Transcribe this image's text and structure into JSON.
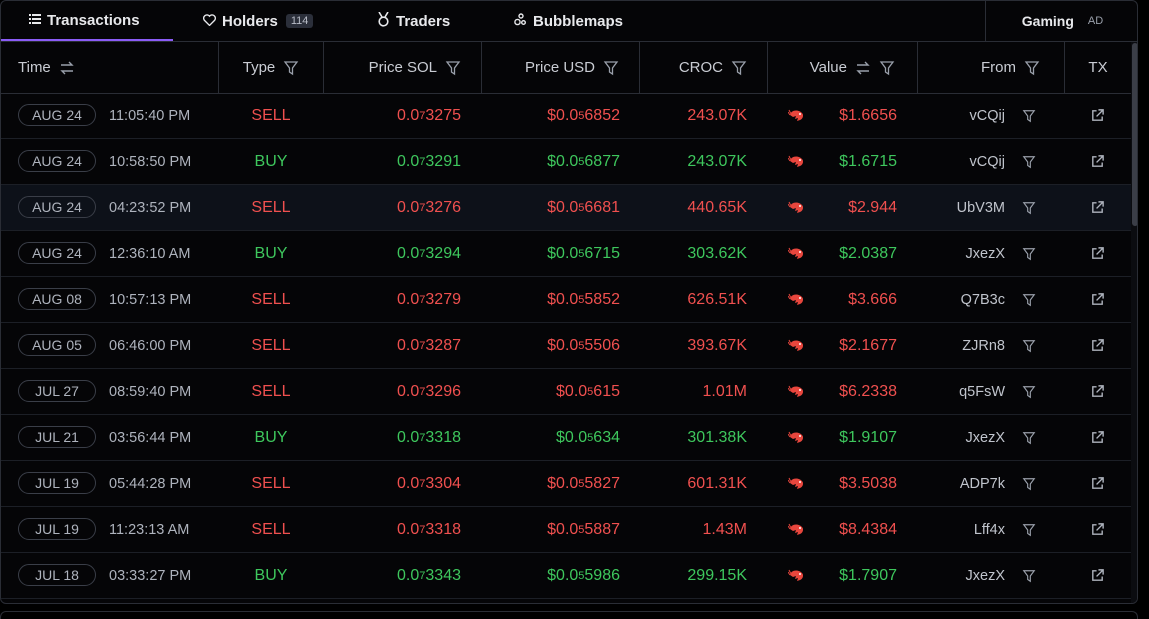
{
  "tabs": [
    {
      "label": "Transactions",
      "icon": "list-icon",
      "active": true
    },
    {
      "label": "Holders",
      "icon": "heart-icon",
      "badge": "114"
    },
    {
      "label": "Traders",
      "icon": "medal-icon"
    },
    {
      "label": "Bubblemaps",
      "icon": "bubbles-icon"
    }
  ],
  "gaming": {
    "label": "Gaming",
    "ad": "AD"
  },
  "columns": {
    "time": "Time",
    "type": "Type",
    "price_sol": "Price SOL",
    "price_usd": "Price USD",
    "croc": "CROC",
    "value": "Value",
    "from": "From",
    "tx": "TX"
  },
  "colors": {
    "sell": "#f0504f",
    "buy": "#3ec75d",
    "accent": "#8b5cf6"
  },
  "rows": [
    {
      "date": "AUG 24",
      "time": "11:05:40 PM",
      "type": "SELL",
      "sol_pre": "0.0",
      "sol_sub": "7",
      "sol_post": "3275",
      "usd_pre": "$0.0",
      "usd_sub": "5",
      "usd_post": "6852",
      "croc": "243.07K",
      "value": "$1.6656",
      "from": "vCQij"
    },
    {
      "date": "AUG 24",
      "time": "10:58:50 PM",
      "type": "BUY",
      "sol_pre": "0.0",
      "sol_sub": "7",
      "sol_post": "3291",
      "usd_pre": "$0.0",
      "usd_sub": "5",
      "usd_post": "6877",
      "croc": "243.07K",
      "value": "$1.6715",
      "from": "vCQij"
    },
    {
      "date": "AUG 24",
      "time": "04:23:52 PM",
      "type": "SELL",
      "sol_pre": "0.0",
      "sol_sub": "7",
      "sol_post": "3276",
      "usd_pre": "$0.0",
      "usd_sub": "5",
      "usd_post": "6681",
      "croc": "440.65K",
      "value": "$2.944",
      "from": "UbV3M",
      "highlight": true
    },
    {
      "date": "AUG 24",
      "time": "12:36:10 AM",
      "type": "BUY",
      "sol_pre": "0.0",
      "sol_sub": "7",
      "sol_post": "3294",
      "usd_pre": "$0.0",
      "usd_sub": "5",
      "usd_post": "6715",
      "croc": "303.62K",
      "value": "$2.0387",
      "from": "JxezX"
    },
    {
      "date": "AUG 08",
      "time": "10:57:13 PM",
      "type": "SELL",
      "sol_pre": "0.0",
      "sol_sub": "7",
      "sol_post": "3279",
      "usd_pre": "$0.0",
      "usd_sub": "5",
      "usd_post": "5852",
      "croc": "626.51K",
      "value": "$3.666",
      "from": "Q7B3c"
    },
    {
      "date": "AUG 05",
      "time": "06:46:00 PM",
      "type": "SELL",
      "sol_pre": "0.0",
      "sol_sub": "7",
      "sol_post": "3287",
      "usd_pre": "$0.0",
      "usd_sub": "5",
      "usd_post": "5506",
      "croc": "393.67K",
      "value": "$2.1677",
      "from": "ZJRn8"
    },
    {
      "date": "JUL 27",
      "time": "08:59:40 PM",
      "type": "SELL",
      "sol_pre": "0.0",
      "sol_sub": "7",
      "sol_post": "3296",
      "usd_pre": "$0.0",
      "usd_sub": "5",
      "usd_post": "615",
      "croc": "1.01M",
      "value": "$6.2338",
      "from": "q5FsW"
    },
    {
      "date": "JUL 21",
      "time": "03:56:44 PM",
      "type": "BUY",
      "sol_pre": "0.0",
      "sol_sub": "7",
      "sol_post": "3318",
      "usd_pre": "$0.0",
      "usd_sub": "5",
      "usd_post": "634",
      "croc": "301.38K",
      "value": "$1.9107",
      "from": "JxezX"
    },
    {
      "date": "JUL 19",
      "time": "05:44:28 PM",
      "type": "SELL",
      "sol_pre": "0.0",
      "sol_sub": "7",
      "sol_post": "3304",
      "usd_pre": "$0.0",
      "usd_sub": "5",
      "usd_post": "5827",
      "croc": "601.31K",
      "value": "$3.5038",
      "from": "ADP7k"
    },
    {
      "date": "JUL 19",
      "time": "11:23:13 AM",
      "type": "SELL",
      "sol_pre": "0.0",
      "sol_sub": "7",
      "sol_post": "3318",
      "usd_pre": "$0.0",
      "usd_sub": "5",
      "usd_post": "5887",
      "croc": "1.43M",
      "value": "$8.4384",
      "from": "Lff4x"
    },
    {
      "date": "JUL 18",
      "time": "03:33:27 PM",
      "type": "BUY",
      "sol_pre": "0.0",
      "sol_sub": "7",
      "sol_post": "3343",
      "usd_pre": "$0.0",
      "usd_sub": "5",
      "usd_post": "5986",
      "croc": "299.15K",
      "value": "$1.7907",
      "from": "JxezX"
    }
  ]
}
